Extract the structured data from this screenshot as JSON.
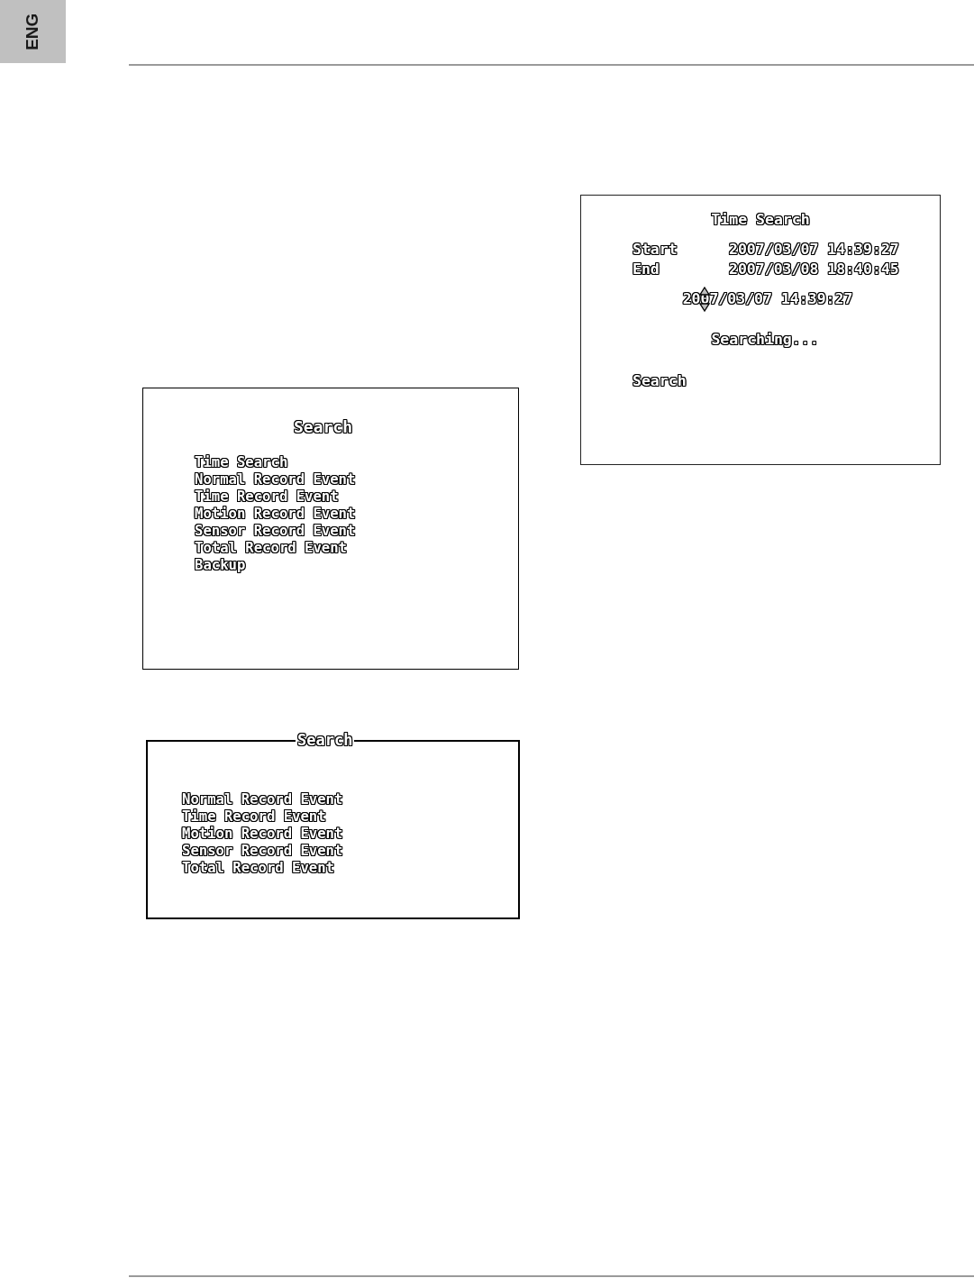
{
  "language_tab": {
    "label": "ENG"
  },
  "search_menu": {
    "title": "Search",
    "items": [
      "Time Search",
      "Normal Record Event",
      "Time Record Event",
      "Motion Record Event",
      "Sensor Record Event",
      "Total Record Event",
      "Backup"
    ]
  },
  "event_menu": {
    "title": "Search",
    "items": [
      "Normal Record Event",
      "Time Record Event",
      "Motion Record Event",
      "Sensor Record Event",
      "Total Record Event"
    ]
  },
  "time_search": {
    "title": "Time Search",
    "fields": [
      {
        "label": "Start",
        "value": "2007/03/07 14:39:27"
      },
      {
        "label": "End",
        "value": "2007/03/08 18:40:45"
      }
    ],
    "edit_value": "2007/03/07 14:39:27",
    "status": "Searching...",
    "action": "Search"
  }
}
